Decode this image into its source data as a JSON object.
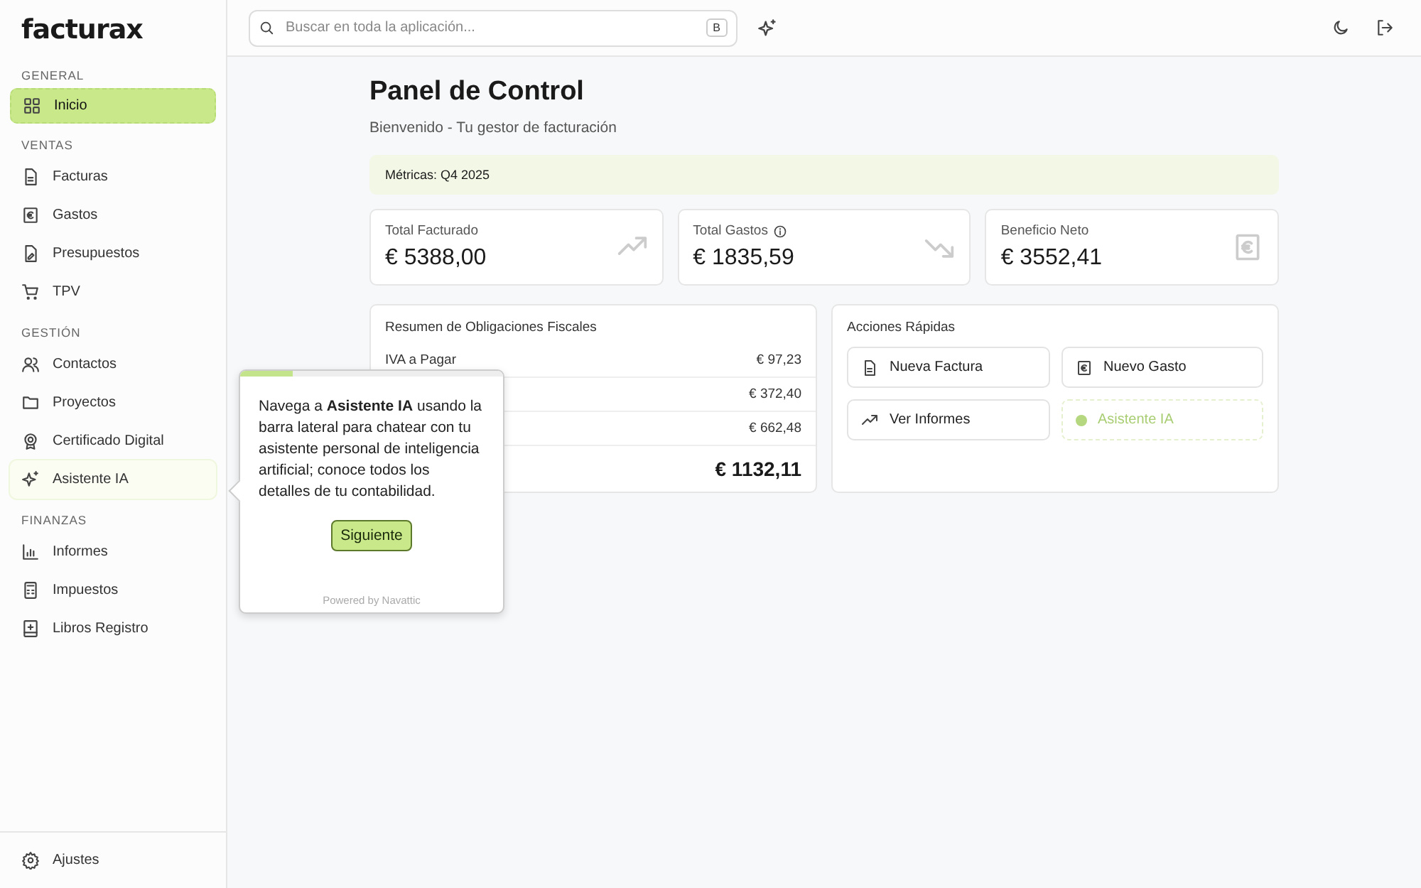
{
  "sidebar": {
    "logo": "facturax",
    "sections": [
      {
        "title": "GENERAL",
        "items": [
          {
            "label": "Inicio",
            "selected": true,
            "highlighted": false
          }
        ]
      },
      {
        "title": "VENTAS",
        "items": [
          {
            "label": "Facturas",
            "selected": false,
            "highlighted": false
          },
          {
            "label": "Gastos",
            "selected": false,
            "highlighted": false
          },
          {
            "label": "Presupuestos",
            "selected": false,
            "highlighted": false
          },
          {
            "label": "TPV",
            "selected": false,
            "highlighted": false
          }
        ]
      },
      {
        "title": "GESTIÓN",
        "items": [
          {
            "label": "Contactos",
            "selected": false,
            "highlighted": false
          },
          {
            "label": "Proyectos",
            "selected": false,
            "highlighted": false
          },
          {
            "label": "Certificado Digital",
            "selected": false,
            "highlighted": false
          },
          {
            "label": "Asistente IA",
            "selected": false,
            "highlighted": true
          }
        ]
      },
      {
        "title": "FINANZAS",
        "items": [
          {
            "label": "Informes",
            "selected": false,
            "highlighted": false
          },
          {
            "label": "Impuestos",
            "selected": false,
            "highlighted": false
          },
          {
            "label": "Libros Registro",
            "selected": false,
            "highlighted": false
          }
        ]
      }
    ],
    "footer": {
      "label": "Ajustes"
    }
  },
  "topbar": {
    "search": {
      "placeholder": "Buscar en toda la aplicación...",
      "shortcut": "B"
    }
  },
  "page": {
    "title": "Panel de Control",
    "subtitle": "Bienvenido - Tu gestor de facturación",
    "period": "Métricas: Q4 2025",
    "stats": [
      {
        "label": "Total Facturado",
        "value": "€ 5388,00",
        "info": false
      },
      {
        "label": "Total Gastos",
        "value": "€ 1835,59",
        "info": true
      },
      {
        "label": "Beneficio Neto",
        "value": "€ 3552,41",
        "info": false
      }
    ],
    "fiscal": {
      "title": "Resumen de Obligaciones Fiscales",
      "rows": [
        {
          "label": "IVA a Pagar",
          "value": "€ 97,23"
        },
        {
          "value": "€ 372,40"
        },
        {
          "value": "€ 662,48"
        }
      ],
      "total": "€ 1132,11"
    },
    "actions": {
      "title": "Acciones Rápidas",
      "items": [
        {
          "label": "Nueva Factura",
          "disabled": false
        },
        {
          "label": "Nuevo Gasto",
          "disabled": false
        },
        {
          "label": "Ver Informes",
          "disabled": false
        },
        {
          "label": "Asistente IA",
          "disabled": true
        }
      ]
    }
  },
  "tour": {
    "level": 0.2,
    "text": "Navega a **Asistente IA** usando la barra lateral para chatear con tu asistente personal de inteligencia artificial; conoce todos los detalles de tu contabilidad.",
    "button": "Siguiente",
    "footer": "Powered by Navattic"
  }
}
